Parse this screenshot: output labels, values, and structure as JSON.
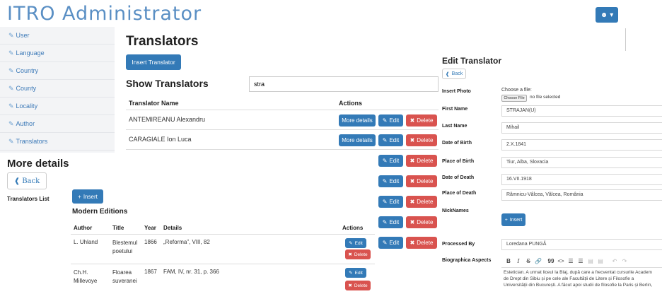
{
  "app": {
    "title": "ITRO Administrator"
  },
  "sidebar": {
    "items": [
      {
        "label": "User"
      },
      {
        "label": "Language"
      },
      {
        "label": "Country"
      },
      {
        "label": "County"
      },
      {
        "label": "Locality"
      },
      {
        "label": "Author"
      },
      {
        "label": "Translators"
      }
    ]
  },
  "translators": {
    "page_title": "Translators",
    "insert_button": "Insert Translator",
    "show_title": "Show Translators",
    "search": {
      "value": "stra",
      "placeholder": ""
    },
    "columns": [
      "Translator Name",
      "Actions"
    ],
    "rows": [
      {
        "name": "ANTEMIREANU Alexandru"
      },
      {
        "name": "CARAGIALE Ion Luca"
      }
    ],
    "actions": {
      "more": "More details",
      "edit": "Edit",
      "delete": "Delete"
    }
  },
  "more_details": {
    "title": "More details",
    "back": "Back",
    "list_label": "Translators List",
    "insert": "Insert",
    "section_title": "Modern Editions",
    "columns": [
      "Author",
      "Title",
      "Year",
      "Details",
      "Actions"
    ],
    "rows": [
      {
        "author": "L. Uhland",
        "title_l1": "Blestemul",
        "title_l2": "poetului",
        "year": "1866",
        "details": "„Reforma”, VIII, 82"
      },
      {
        "author_l1": "Ch.H.",
        "author_l2": "Millevoye",
        "title_l1": "Floarea",
        "title_l2": "suveranei",
        "year": "1867",
        "details": "FAM, IV, nr. 31, p. 366"
      }
    ],
    "edit": "Edit",
    "delete": "Delete"
  },
  "edit_translator": {
    "title": "Edit Translator",
    "back": "Back",
    "labels": {
      "photo": "Insert Photo",
      "first_name": "First Name",
      "last_name": "Last Name",
      "dob": "Date of Birth",
      "pob": "Place of Birth",
      "dod": "Date of Death",
      "pod": "Place of Death",
      "nick": "NickNames",
      "processed": "Processed By",
      "bio": "Biographica Aspects"
    },
    "file": {
      "label": "Choose a file:",
      "button": "Choose File",
      "status": "no file selected"
    },
    "values": {
      "first_name": "STRAJAN(U)",
      "last_name": "Mihail",
      "dob": "2.X.1841",
      "pob": "Tiur, Alba, Slovacia",
      "dod": "16.VII.1918",
      "pod": "Râmnicu-Vâlcea, Vâlcea, România",
      "processed": "Loredana PUNGĂ"
    },
    "insert": "Insert",
    "toolbar": [
      "B",
      "I",
      "S",
      "link",
      "99",
      "<>",
      "ul",
      "ol",
      "outdent",
      "indent",
      "undo",
      "redo"
    ],
    "bio_lines": [
      "Estetician. A urmat liceul la Blaj, după care a frecventat cursurile Academ",
      "de Drept din Sibiu și pe cele ale Facultății de Litere și Filosofie a",
      "Universității din București. A făcut apoi studii de filosofie la Paris și Berlin,"
    ]
  }
}
